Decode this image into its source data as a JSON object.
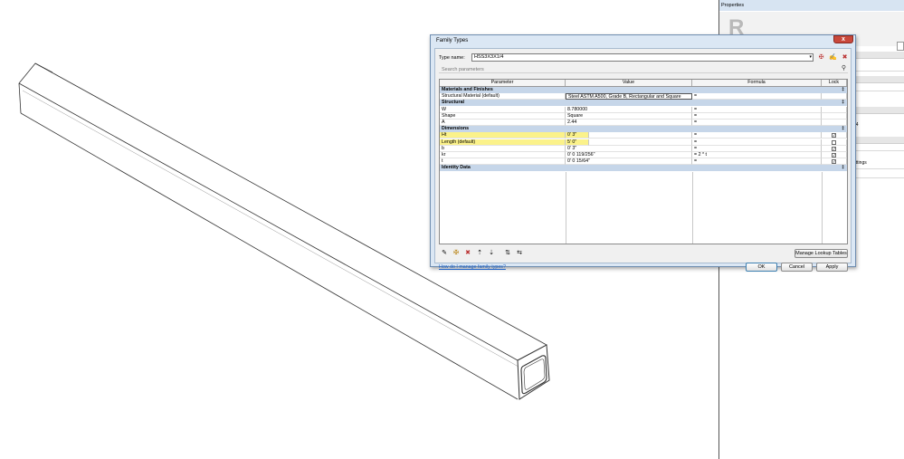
{
  "properties": {
    "title": "Properties",
    "logo": "R",
    "partial_text_1": "14",
    "partial_text_2": "ettings"
  },
  "dialog": {
    "title": "Family Types",
    "close_label": "x",
    "type_name_label": "Type name:",
    "type_name_value": "HSS3X3X1/4",
    "search_placeholder": "Search parameters",
    "columns": [
      "Parameter",
      "Value",
      "Formula",
      "Lock"
    ],
    "groups": [
      {
        "name": "Materials and Finishes",
        "rows": [
          {
            "param": "Structural Material (default)",
            "value": "Steel ASTM A500, Grade B, Rectangular and Square",
            "formula": "=",
            "lock": null,
            "highlight": false
          }
        ]
      },
      {
        "name": "Structural",
        "rows": [
          {
            "param": "W",
            "value": "8.780000",
            "formula": "=",
            "lock": null,
            "highlight": false
          },
          {
            "param": "Shape",
            "value": "Square",
            "formula": "=",
            "lock": null,
            "highlight": false
          },
          {
            "param": "A",
            "value": "2.44",
            "formula": "=",
            "lock": null,
            "highlight": false
          }
        ]
      },
      {
        "name": "Dimensions",
        "rows": [
          {
            "param": "Ht",
            "value": "0'  3\"",
            "formula": "=",
            "lock": true,
            "highlight": true
          },
          {
            "param": "Length (default)",
            "value": "5'  0\"",
            "formula": "=",
            "lock": false,
            "highlight": true
          },
          {
            "param": "b",
            "value": "0'  3\"",
            "formula": "=",
            "lock": true,
            "highlight": false
          },
          {
            "param": "kr",
            "value": "0'  0 119/256\"",
            "formula": "= 2 * t",
            "lock": true,
            "highlight": false
          },
          {
            "param": "t",
            "value": "0'  0 15/64\"",
            "formula": "=",
            "lock": true,
            "highlight": false
          }
        ]
      },
      {
        "name": "Identity Data",
        "rows": []
      }
    ],
    "collapse_glyph": "‡",
    "check_glyph": "✓",
    "icon_glyphs": {
      "pencil-icon": "✎",
      "new-param-icon": "✠",
      "delete-param-icon": "✖",
      "move-up-icon": "⇡",
      "move-down-icon": "⇣",
      "sort-asc-icon": "⇅",
      "sort-desc-icon": "⇆",
      "new-type-icon": "✠",
      "rename-type-icon": "✍",
      "delete-type-icon": "✖",
      "search-icon": "⚲",
      "dropdown-arrow-icon": "▾"
    },
    "manage_lookup_label": "Manage Lookup Tables",
    "help_link": "How do I manage family types?",
    "ok_label": "OK",
    "cancel_label": "Cancel",
    "apply_label": "Apply"
  }
}
